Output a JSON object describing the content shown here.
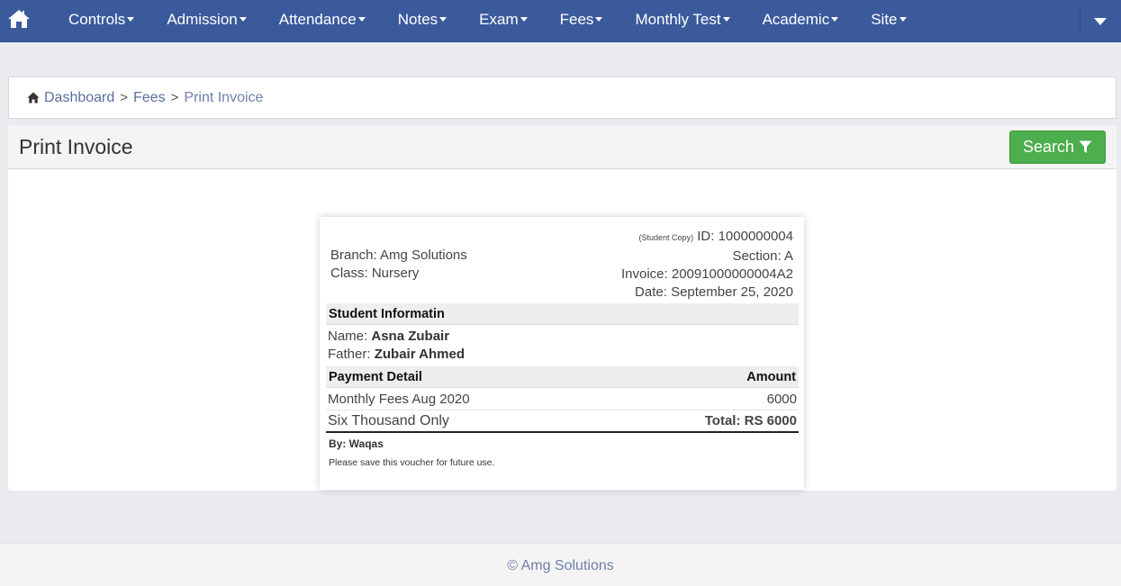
{
  "navbar": {
    "items": [
      {
        "label": "Controls"
      },
      {
        "label": "Admission"
      },
      {
        "label": "Attendance"
      },
      {
        "label": "Notes"
      },
      {
        "label": "Exam"
      },
      {
        "label": "Fees"
      },
      {
        "label": "Monthly Test"
      },
      {
        "label": "Academic"
      },
      {
        "label": "Site"
      }
    ],
    "home_icon": "home-icon",
    "bg_color": "#3a5a9c"
  },
  "breadcrumb": {
    "items": [
      "Dashboard",
      "Fees"
    ],
    "separator": ">",
    "current": "Print Invoice"
  },
  "panel": {
    "title": "Print Invoice",
    "search_label": "Search",
    "search_color": "#4cae4c"
  },
  "invoice": {
    "copy_label": "(Student Copy)",
    "id_line": "ID: 1000000004",
    "branch": "Branch: Amg Solutions",
    "class": "Class: Nursery",
    "section": "Section: A",
    "invoice_no": "Invoice: 20091000000004A2",
    "date": "Date: September 25, 2020",
    "student_heading": "Student Informatin",
    "name_label": "Name:",
    "name_value": "Asna Zubair",
    "father_label": "Father:",
    "father_value": "Zubair Ahmed",
    "payment_heading": "Payment Detail",
    "amount_heading": "Amount",
    "items": [
      {
        "desc": "Monthly Fees Aug 2020",
        "amount": "6000"
      }
    ],
    "amount_words": "Six Thousand Only",
    "total": "Total: RS 6000",
    "by": "By: Waqas",
    "note": "Please save this voucher for future use."
  },
  "footer": {
    "text": "© Amg Solutions"
  }
}
